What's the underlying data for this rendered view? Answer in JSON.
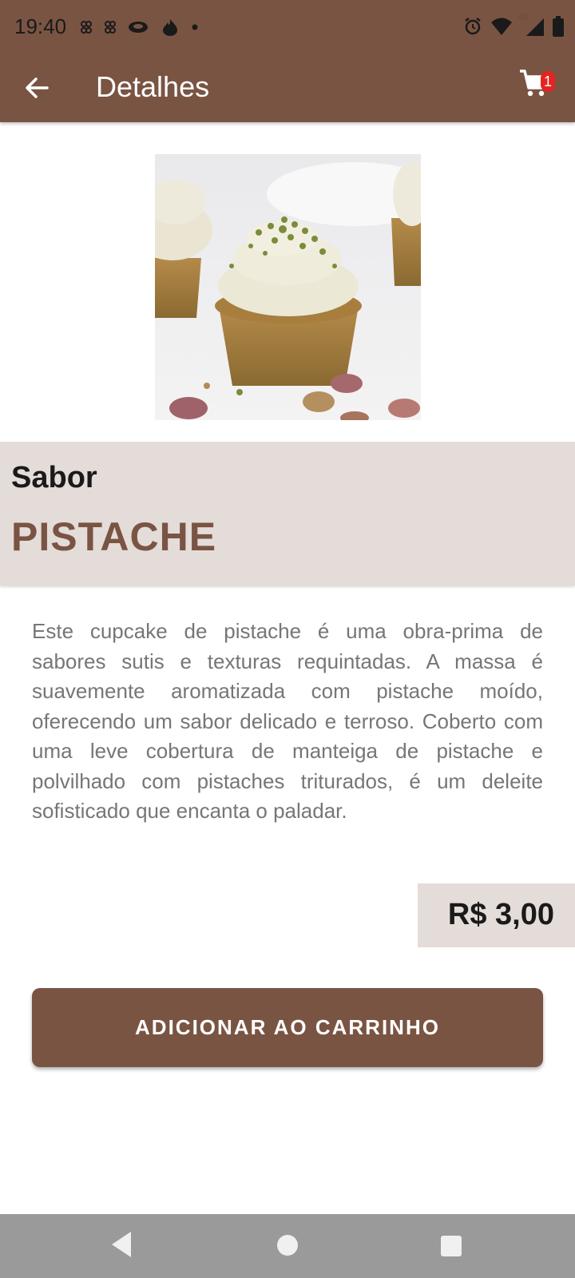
{
  "status_bar": {
    "time": "19:40",
    "network": "4G"
  },
  "toolbar": {
    "title": "Detalhes",
    "cart_count": "1",
    "back_icon": "arrow-left-icon",
    "cart_icon": "shopping-cart-icon"
  },
  "product": {
    "image_alt": "pistachio-cupcake-photo",
    "flavor_label": "Sabor",
    "flavor_name": "PISTACHE",
    "description": "Este cupcake de pistache é uma obra-prima de sabores sutis e texturas requintadas. A massa é suavemente aromatizada com pistache moído, oferecendo um sabor delicado e terroso. Coberto com uma leve cobertura de manteiga de pistache e polvilhado com pistaches triturados, é um deleite sofisticado que encanta o paladar.",
    "price": "R$ 3,00"
  },
  "actions": {
    "add_to_cart_label": "ADICIONAR AO CARRINHO"
  },
  "colors": {
    "primary": "#7a5443",
    "panel": "#e4dcd9",
    "badge": "#e52421"
  }
}
